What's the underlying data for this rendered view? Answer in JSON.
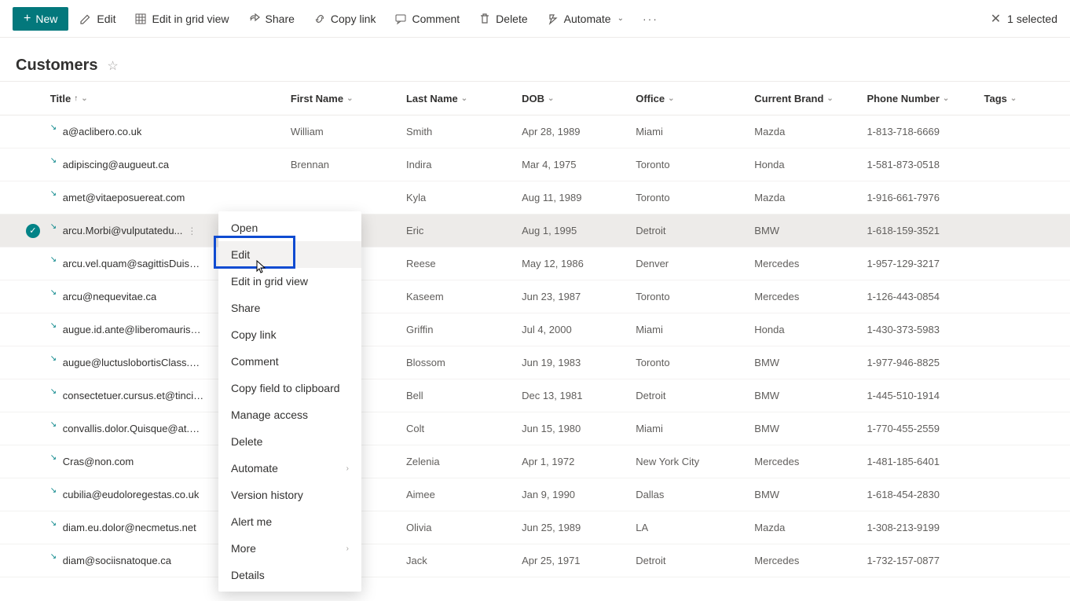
{
  "toolbar": {
    "new_label": "New",
    "edit_label": "Edit",
    "grid_label": "Edit in grid view",
    "share_label": "Share",
    "copylink_label": "Copy link",
    "comment_label": "Comment",
    "delete_label": "Delete",
    "automate_label": "Automate",
    "selected_label": "1 selected"
  },
  "list": {
    "title": "Customers"
  },
  "columns": {
    "title": "Title",
    "first_name": "First Name",
    "last_name": "Last Name",
    "dob": "DOB",
    "office": "Office",
    "brand": "Current Brand",
    "phone": "Phone Number",
    "tags": "Tags"
  },
  "rows": [
    {
      "title": "a@aclibero.co.uk",
      "fn": "William",
      "ln": "Smith",
      "dob": "Apr 28, 1989",
      "office": "Miami",
      "brand": "Mazda",
      "phone": "1-813-718-6669",
      "selected": false
    },
    {
      "title": "adipiscing@augueut.ca",
      "fn": "Brennan",
      "ln": "Indira",
      "dob": "Mar 4, 1975",
      "office": "Toronto",
      "brand": "Honda",
      "phone": "1-581-873-0518",
      "selected": false
    },
    {
      "title": "amet@vitaeposuereat.com",
      "fn": "",
      "ln": "Kyla",
      "dob": "Aug 11, 1989",
      "office": "Toronto",
      "brand": "Mazda",
      "phone": "1-916-661-7976",
      "selected": false
    },
    {
      "title": "arcu.Morbi@vulputatedu...",
      "fn": "",
      "ln": "Eric",
      "dob": "Aug 1, 1995",
      "office": "Detroit",
      "brand": "BMW",
      "phone": "1-618-159-3521",
      "selected": true
    },
    {
      "title": "arcu.vel.quam@sagittisDuisgravid",
      "fn": "",
      "ln": "Reese",
      "dob": "May 12, 1986",
      "office": "Denver",
      "brand": "Mercedes",
      "phone": "1-957-129-3217",
      "selected": false
    },
    {
      "title": "arcu@nequevitae.ca",
      "fn": "",
      "ln": "Kaseem",
      "dob": "Jun 23, 1987",
      "office": "Toronto",
      "brand": "Mercedes",
      "phone": "1-126-443-0854",
      "selected": false
    },
    {
      "title": "augue.id.ante@liberomaurisaliqua",
      "fn": "",
      "ln": "Griffin",
      "dob": "Jul 4, 2000",
      "office": "Miami",
      "brand": "Honda",
      "phone": "1-430-373-5983",
      "selected": false
    },
    {
      "title": "augue@luctuslobortisClass.co.uk",
      "fn": "",
      "ln": "Blossom",
      "dob": "Jun 19, 1983",
      "office": "Toronto",
      "brand": "BMW",
      "phone": "1-977-946-8825",
      "selected": false
    },
    {
      "title": "consectetuer.cursus.et@tinciduntD",
      "fn": "",
      "ln": "Bell",
      "dob": "Dec 13, 1981",
      "office": "Detroit",
      "brand": "BMW",
      "phone": "1-445-510-1914",
      "selected": false
    },
    {
      "title": "convallis.dolor.Quisque@at.co.uk",
      "fn": "",
      "ln": "Colt",
      "dob": "Jun 15, 1980",
      "office": "Miami",
      "brand": "BMW",
      "phone": "1-770-455-2559",
      "selected": false
    },
    {
      "title": "Cras@non.com",
      "fn": "",
      "ln": "Zelenia",
      "dob": "Apr 1, 1972",
      "office": "New York City",
      "brand": "Mercedes",
      "phone": "1-481-185-6401",
      "selected": false
    },
    {
      "title": "cubilia@eudoloregestas.co.uk",
      "fn": "",
      "ln": "Aimee",
      "dob": "Jan 9, 1990",
      "office": "Dallas",
      "brand": "BMW",
      "phone": "1-618-454-2830",
      "selected": false
    },
    {
      "title": "diam.eu.dolor@necmetus.net",
      "fn": "",
      "ln": "Olivia",
      "dob": "Jun 25, 1989",
      "office": "LA",
      "brand": "Mazda",
      "phone": "1-308-213-9199",
      "selected": false
    },
    {
      "title": "diam@sociisnatoque.ca",
      "fn": "",
      "ln": "Jack",
      "dob": "Apr 25, 1971",
      "office": "Detroit",
      "brand": "Mercedes",
      "phone": "1-732-157-0877",
      "selected": false
    }
  ],
  "context_menu": {
    "open": "Open",
    "edit": "Edit",
    "edit_grid": "Edit in grid view",
    "share": "Share",
    "copy_link": "Copy link",
    "comment": "Comment",
    "copy_field": "Copy field to clipboard",
    "manage_access": "Manage access",
    "delete": "Delete",
    "automate": "Automate",
    "version_history": "Version history",
    "alert_me": "Alert me",
    "more": "More",
    "details": "Details"
  }
}
